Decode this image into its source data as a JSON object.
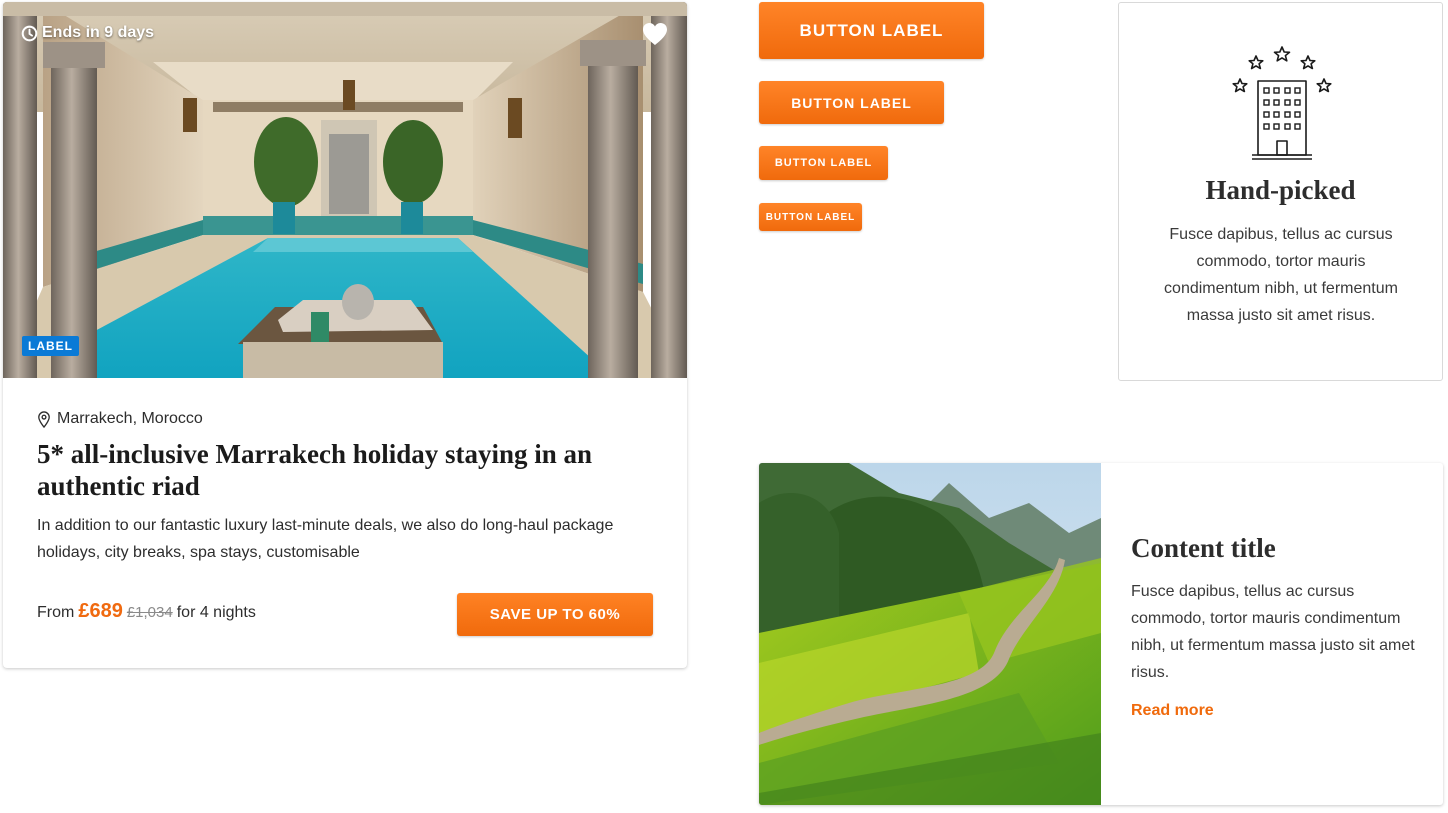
{
  "deal_card": {
    "ends_text": "Ends in 9 days",
    "label": "LABEL",
    "location": "Marrakech, Morocco",
    "title": "5* all-inclusive Marrakech holiday staying in an authentic riad",
    "description": "In addition to our fantastic luxury last-minute deals, we also do long-haul package holidays, city breaks, spa stays, customisable",
    "price_prefix": "From",
    "price_now": "£689",
    "price_was": "£1,034",
    "price_suffix": "for 4 nights",
    "cta_label": "SAVE UP TO 60%",
    "icons": [
      "clock-icon",
      "heart-icon",
      "map-pin-icon"
    ]
  },
  "buttons": {
    "xl_label": "BUTTON LABEL",
    "lg_label": "BUTTON LABEL",
    "md_label": "BUTTON LABEL",
    "sm_label": "BUTTON LABEL"
  },
  "feature_card": {
    "icon": "hotel-stars-icon",
    "title": "Hand-picked",
    "text": "Fusce dapibus, tellus ac cursus commodo, tortor mauris condimentum nibh, ut fermentum massa justo sit amet risus."
  },
  "content_card": {
    "title": "Content title",
    "text": "Fusce dapibus, tellus ac cursus commodo, tortor mauris condimentum nibh, ut fermentum massa justo sit amet risus.",
    "link_label": "Read more"
  },
  "colors": {
    "accent": "#f06a0c",
    "label_blue": "#0a7ad6",
    "text_dark": "#2d2d2d"
  }
}
